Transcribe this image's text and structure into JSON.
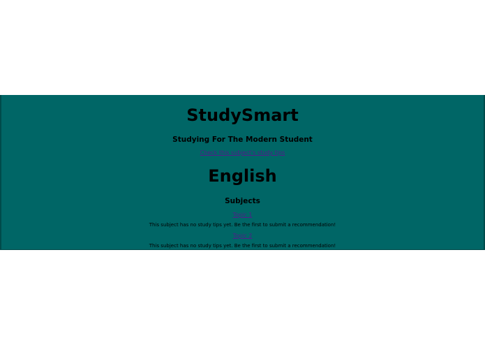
{
  "site": {
    "title": "StudySmart",
    "tagline": "Studying For The Modern Student",
    "top_link": "Check this subject's study tips"
  },
  "subject": {
    "title": "English",
    "section_heading": "Subjects",
    "entries": [
      {
        "link": "Topic 1",
        "note": "This subject has no study tips yet. Be the first to submit a recommendation!"
      },
      {
        "link": "Topic 2",
        "note": "This subject has no study tips yet. Be the first to submit a recommendation!"
      }
    ]
  },
  "colors": {
    "panel_background": "#006666",
    "link": "#551a8b",
    "page_background": "#ffffff"
  }
}
